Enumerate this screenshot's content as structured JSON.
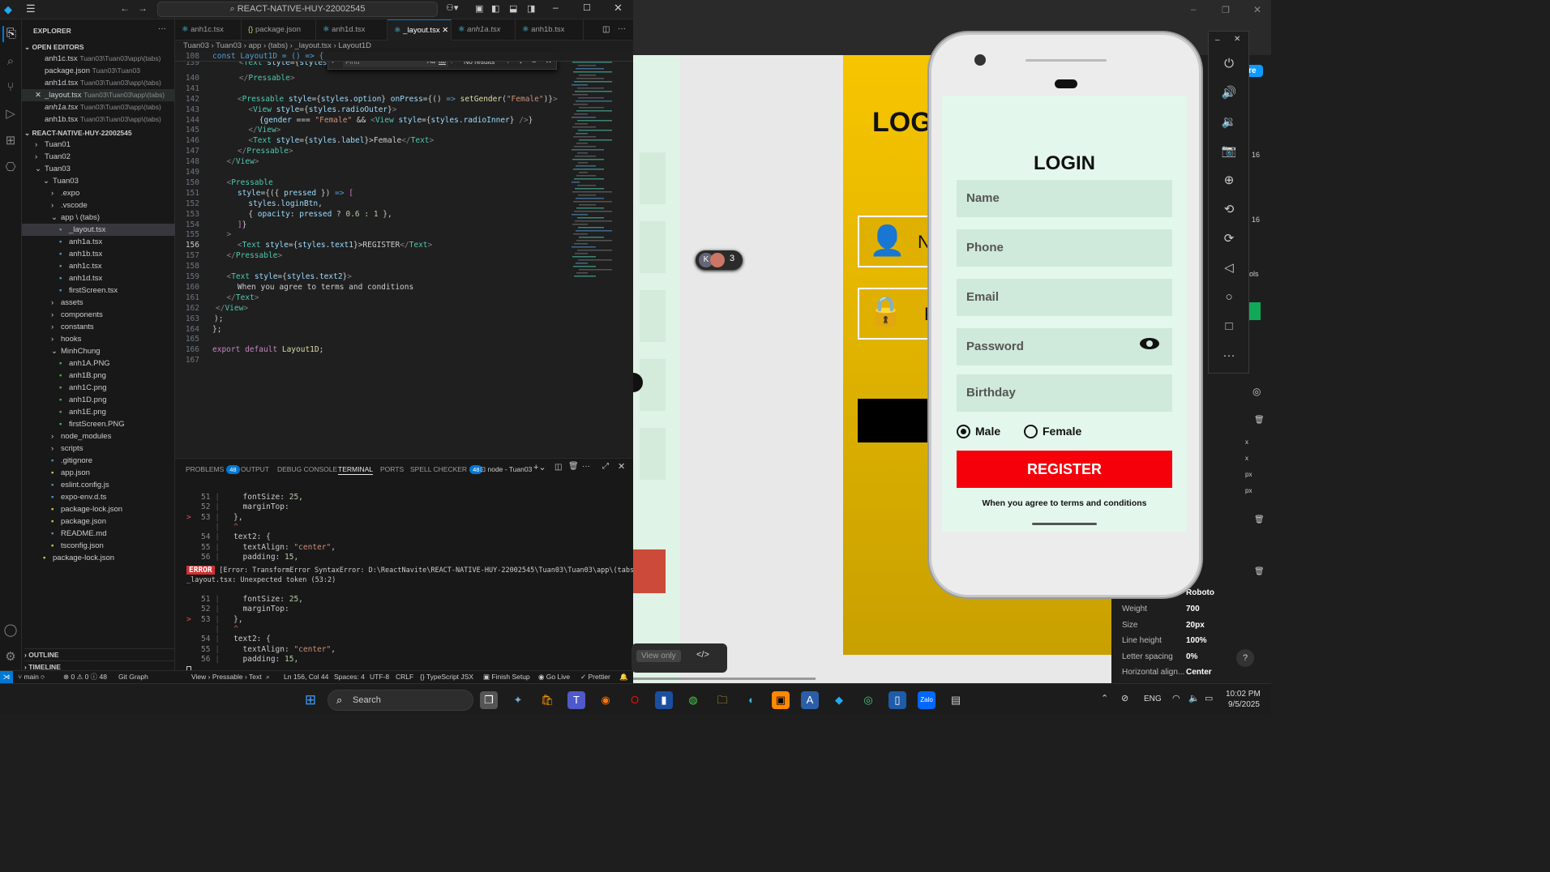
{
  "titlebar": {
    "search": "REACT-NATIVE-HUY-22002545"
  },
  "explorer": {
    "title": "EXPLORER",
    "open_editors_header": "OPEN EDITORS",
    "open_editors": [
      {
        "name": "anh1c.tsx",
        "path": "Tuan03\\Tuan03\\app\\(tabs)"
      },
      {
        "name": "package.json",
        "path": "Tuan03\\Tuan03"
      },
      {
        "name": "anh1d.tsx",
        "path": "Tuan03\\Tuan03\\app\\(tabs)"
      },
      {
        "name": "_layout.tsx",
        "path": "Tuan03\\Tuan03\\app\\(tabs)"
      },
      {
        "name": "anh1a.tsx",
        "path": "Tuan03\\Tuan03\\app\\(tabs)"
      },
      {
        "name": "anh1b.tsx",
        "path": "Tuan03\\Tuan03\\app\\(tabs)"
      }
    ],
    "project_header": "REACT-NATIVE-HUY-22002545",
    "tree": [
      "Tuan01",
      "Tuan02",
      "Tuan03",
      "Tuan03",
      ".expo",
      ".vscode",
      "app \\ (tabs)",
      "_layout.tsx",
      "anh1a.tsx",
      "anh1b.tsx",
      "anh1c.tsx",
      "anh1d.tsx",
      "firstScreen.tsx",
      "assets",
      "components",
      "constants",
      "hooks",
      "MinhChung",
      "anh1A.PNG",
      "anh1B.png",
      "anh1C.png",
      "anh1D.png",
      "anh1E.png",
      "firstScreen.PNG",
      "node_modules",
      "scripts",
      ".gitignore",
      "app.json",
      "eslint.config.js",
      "expo-env.d.ts",
      "package-lock.json",
      "package.json",
      "README.md",
      "tsconfig.json",
      "package-lock.json"
    ],
    "outline": "OUTLINE",
    "timeline": "TIMELINE"
  },
  "tabs": [
    "anh1c.tsx",
    "package.json",
    "anh1d.tsx",
    "_layout.tsx",
    "anh1a.tsx",
    "anh1b.tsx"
  ],
  "breadcrumb": "Tuan03 › Tuan03 › app › (tabs) › _layout.tsx › Layout1D",
  "find": {
    "placeholder": "Find",
    "result": "No results",
    "opt1": "Aa",
    "opt2": "ab",
    "opt3": ".*"
  },
  "sticky": {
    "num": "108",
    "text": "const Layout1D = () => {"
  },
  "panel": {
    "problems": "PROBLEMS",
    "problems_count": "48",
    "output": "OUTPUT",
    "debug": "DEBUG CONSOLE",
    "terminal": "TERMINAL",
    "ports": "PORTS",
    "spell": "SPELL CHECKER",
    "spell_count": "48",
    "shell": "node - Tuan03"
  },
  "terminal": {
    "error_tag": "ERROR",
    "error_text": "[Error: TransformError SyntaxError: D:\\ReactNavite\\REACT-NATIVE-HUY-22002545\\Tuan03\\Tuan03\\app\\(tabs)\\",
    "error_text2": "_layout.tsx: Unexpected token (53:2)"
  },
  "statusbar": {
    "branch": "main",
    "errors": "0",
    "warnings": "0",
    "info": "48",
    "gitgraph": "Git Graph",
    "crumb": "View › Pressable › Text",
    "pos": "Ln 156, Col 44",
    "spaces": "Spaces: 4",
    "enc": "UTF-8",
    "eol": "CRLF",
    "lang": "TypeScript JSX",
    "finish": "Finish Setup",
    "golive": "Go Live",
    "prettier": "Prettier"
  },
  "phone": {
    "title": "LOGIN",
    "fields": [
      "Name",
      "Phone",
      "Email",
      "Password",
      "Birthday"
    ],
    "male": "Male",
    "female": "Female",
    "register": "REGISTER",
    "terms": "When you agree to terms and conditions"
  },
  "preview": {
    "behind_title": "LOG",
    "field1": "N",
    "field2": "P",
    "view_only": "View only",
    "avatar_initial": "K",
    "avatar_count": "3"
  },
  "inspector": {
    "font": "Roboto",
    "rows": [
      {
        "k": "Weight",
        "v": "700"
      },
      {
        "k": "Size",
        "v": "20px"
      },
      {
        "k": "Line height",
        "v": "100%"
      },
      {
        "k": "Letter spacing",
        "v": "0%"
      },
      {
        "k": "Horizontal align...",
        "v": "Center"
      }
    ],
    "side": [
      "16",
      "16",
      "ols",
      "x",
      "x",
      "px",
      "px"
    ],
    "btn": "ure",
    "q": "?"
  },
  "taskbar": {
    "search": "Search",
    "lang": "ENG",
    "time": "10:02 PM",
    "date": "9/5/2025"
  }
}
